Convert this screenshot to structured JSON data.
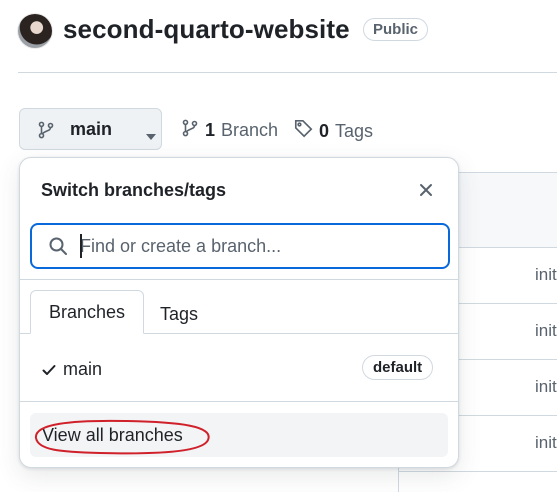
{
  "repo": {
    "name": "second-quarto-website",
    "visibility": "Public"
  },
  "branch_selector": {
    "current": "main",
    "branches_count": "1",
    "branches_label": "Branch",
    "tags_count": "0",
    "tags_label": "Tags"
  },
  "dropdown": {
    "title": "Switch branches/tags",
    "search_placeholder": "Find or create a branch...",
    "tabs": [
      "Branches",
      "Tags"
    ],
    "active_tab": "Branches",
    "branches": [
      {
        "name": "main",
        "badge": "default",
        "selected": true
      }
    ],
    "footer_link": "View all branches"
  },
  "background_list": {
    "commit_messages": [
      "init",
      "init",
      "init",
      "init"
    ]
  },
  "colors": {
    "accent_blue": "#0969da",
    "annotation_red": "#d0202a",
    "border": "#d1d9e0"
  },
  "icons": [
    "branch-icon",
    "caret-down-icon",
    "tag-icon",
    "close-icon",
    "search-icon",
    "check-icon"
  ]
}
